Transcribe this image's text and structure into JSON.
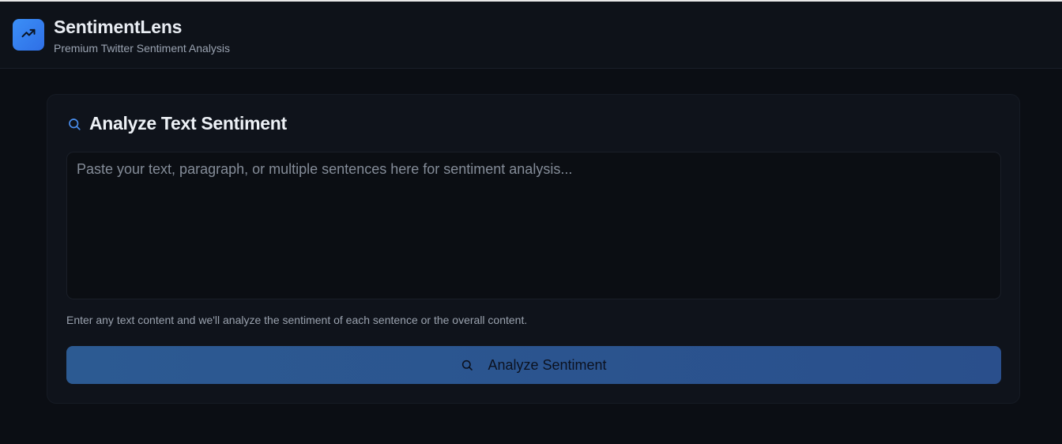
{
  "header": {
    "app_name": "SentimentLens",
    "tagline": "Premium Twitter Sentiment Analysis",
    "logo_icon": "trending-up-icon"
  },
  "analyzer": {
    "title": "Analyze Text Sentiment",
    "title_icon": "search-icon",
    "input": {
      "value": "",
      "placeholder": "Paste your text, paragraph, or multiple sentences here for sentiment analysis..."
    },
    "hint": "Enter any text content and we'll analyze the sentiment of each sentence or the overall content.",
    "submit_label": "Analyze Sentiment",
    "submit_icon": "search-icon"
  },
  "colors": {
    "background": "#0b0e14",
    "accent": "#3b8ff7",
    "button": "#2c5a92"
  }
}
